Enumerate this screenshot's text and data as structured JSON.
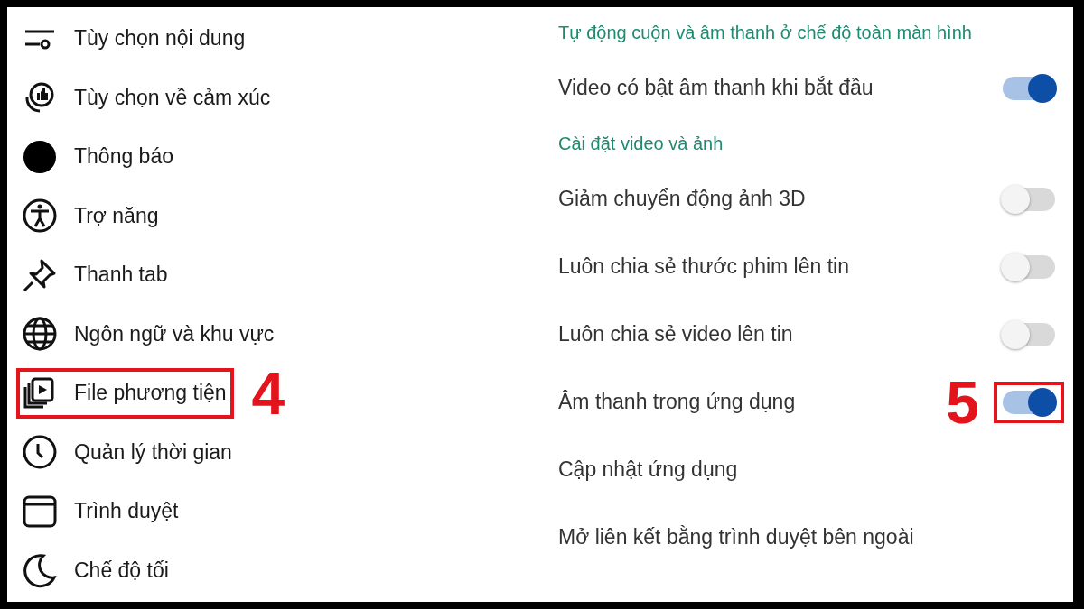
{
  "menu": [
    {
      "label": "Tùy chọn nội dung"
    },
    {
      "label": "Tùy chọn về cảm xúc"
    },
    {
      "label": "Thông báo"
    },
    {
      "label": "Trợ năng"
    },
    {
      "label": "Thanh tab"
    },
    {
      "label": "Ngôn ngữ và khu vực"
    },
    {
      "label": "File phương tiện",
      "callout": "4"
    },
    {
      "label": "Quản lý thời gian"
    },
    {
      "label": "Trình duyệt"
    },
    {
      "label": "Chế độ tối"
    }
  ],
  "settings": [
    {
      "kind": "header",
      "label": "Tự động cuộn và âm thanh ở chế độ toàn màn hình"
    },
    {
      "kind": "toggle",
      "label": "Video có bật âm thanh khi bắt đầu",
      "on": true
    },
    {
      "kind": "header",
      "label": "Cài đặt video và ảnh"
    },
    {
      "kind": "toggle",
      "label": "Giảm chuyển động ảnh 3D",
      "on": false
    },
    {
      "kind": "toggle",
      "label": "Luôn chia sẻ thước phim lên tin",
      "on": false
    },
    {
      "kind": "toggle",
      "label": "Luôn chia sẻ video lên tin",
      "on": false
    },
    {
      "kind": "toggle",
      "label": "Âm thanh trong ứng dụng",
      "on": true,
      "callout": "5"
    },
    {
      "kind": "link",
      "label": "Cập nhật ứng dụng"
    },
    {
      "kind": "link",
      "label": "Mở liên kết bằng trình duyệt bên ngoài"
    }
  ]
}
